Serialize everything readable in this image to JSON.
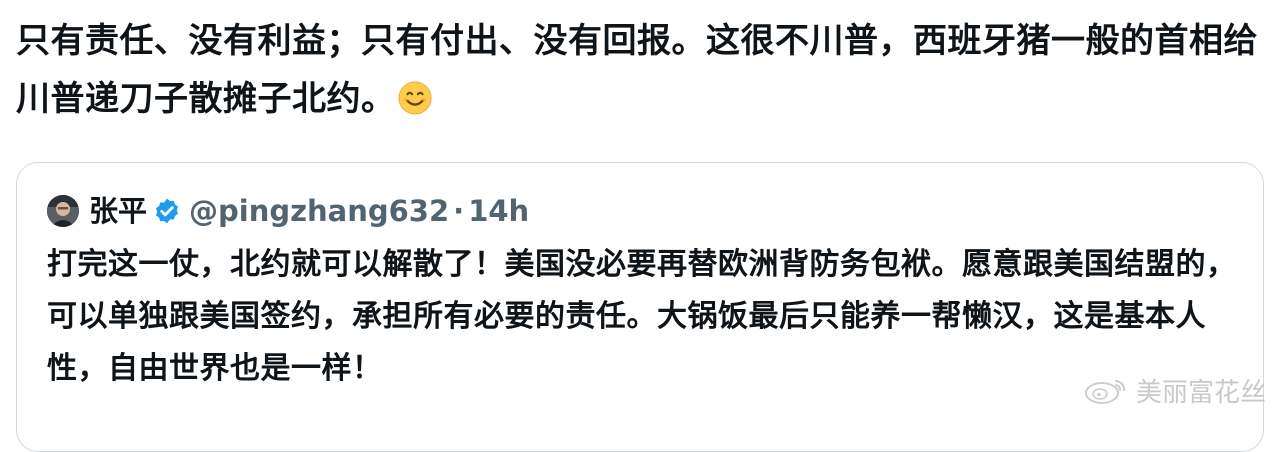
{
  "post": {
    "text": "只有责任、没有利益；只有付出、没有回报。这很不川普，西班牙猪一般的首相给川普递刀子散摊子北约。",
    "emoji": "smiling-face-emoji"
  },
  "quoted_post": {
    "author_name": "张平",
    "author_handle": "@pingzhang632",
    "separator": "·",
    "time": "14h",
    "verified_color": "#1d9bf0",
    "text": "打完这一仗，北约就可以解散了！美国没必要再替欧洲背防务包袱。愿意跟美国结盟的，可以单独跟美国签约，承担所有必要的责任。大锅饭最后只能养一帮懒汉，这是基本人性，自由世界也是一样！"
  },
  "watermark": {
    "text": "美丽富花丝",
    "icon": "weibo-logo-icon"
  }
}
